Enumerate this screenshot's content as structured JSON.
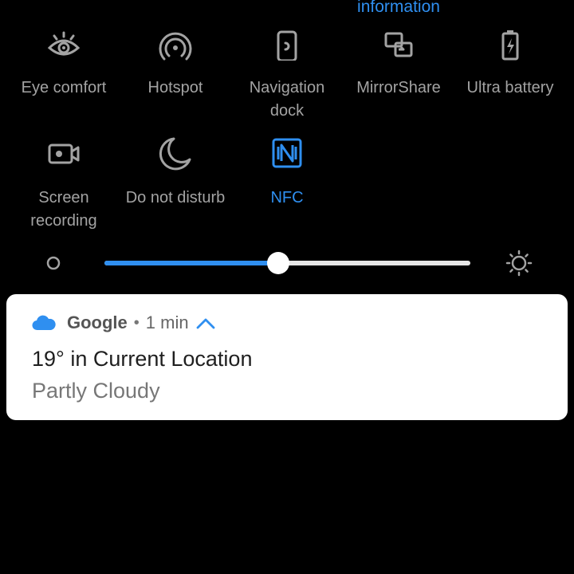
{
  "top_partial_label": "information",
  "colors": {
    "accent": "#2f8ff0",
    "tile_inactive": "#a3a3a3",
    "background": "#000000",
    "card": "#ffffff"
  },
  "quick_settings": {
    "tiles": [
      {
        "label": "Eye comfort",
        "icon": "eye-icon",
        "active": false
      },
      {
        "label": "Hotspot",
        "icon": "hotspot-icon",
        "active": false
      },
      {
        "label": "Navigation\ndock",
        "icon": "navigation-dock-icon",
        "active": false
      },
      {
        "label": "MirrorShare",
        "icon": "mirrorshare-icon",
        "active": false
      },
      {
        "label": "Ultra battery",
        "icon": "battery-icon",
        "active": false
      },
      {
        "label": "Screen\nrecording",
        "icon": "screen-recording-icon",
        "active": false
      },
      {
        "label": "Do not disturb",
        "icon": "moon-icon",
        "active": false
      },
      {
        "label": "NFC",
        "icon": "nfc-icon",
        "active": true
      }
    ]
  },
  "brightness": {
    "level": 0.475,
    "low_icon": "brightness-low-icon",
    "high_icon": "brightness-high-icon"
  },
  "notification": {
    "app_icon": "cloud-icon",
    "app_name": "Google",
    "separator": "•",
    "time": "1 min",
    "expand_icon": "chevron-up-icon",
    "title": "19° in Current Location",
    "text": "Partly Cloudy"
  }
}
